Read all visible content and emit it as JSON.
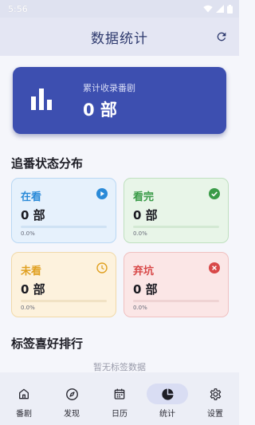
{
  "status_bar": {
    "time": "5:56"
  },
  "app_bar": {
    "title": "数据统计",
    "refresh_icon": "refresh-icon"
  },
  "summary": {
    "label": "累计收录番剧",
    "value": "0 部",
    "icon": "bar-chart-icon"
  },
  "status_section": {
    "title": "追番状态分布",
    "cards": [
      {
        "label": "在看",
        "value": "0 部",
        "percent": "0.0%",
        "progress": 0,
        "icon": "play-circle-icon",
        "accent": "#2a8ad8",
        "bg": "#e6f1fc",
        "border": "#b9d8f4",
        "track": "#cfe2f4"
      },
      {
        "label": "看完",
        "value": "0 部",
        "percent": "0.0%",
        "progress": 0,
        "icon": "check-circle-icon",
        "accent": "#3a9b48",
        "bg": "#e8f5e8",
        "border": "#bfe0bf",
        "track": "#d3e9d3"
      },
      {
        "label": "未看",
        "value": "0 部",
        "percent": "0.0%",
        "progress": 0,
        "icon": "clock-icon",
        "accent": "#e0a020",
        "bg": "#fdf2dd",
        "border": "#f1d9a8",
        "track": "#f1e2c4"
      },
      {
        "label": "弃坑",
        "value": "0 部",
        "percent": "0.0%",
        "progress": 0,
        "icon": "cancel-circle-icon",
        "accent": "#d84848",
        "bg": "#fbe6e6",
        "border": "#f0c0c0",
        "track": "#efd3d3"
      }
    ]
  },
  "tags_section": {
    "title": "标签喜好排行",
    "empty_text": "暂无标签数据"
  },
  "bottom_nav": {
    "items": [
      {
        "label": "番剧",
        "icon": "home-icon",
        "active": false
      },
      {
        "label": "发现",
        "icon": "compass-icon",
        "active": false
      },
      {
        "label": "日历",
        "icon": "calendar-icon",
        "active": false
      },
      {
        "label": "统计",
        "icon": "pie-chart-icon",
        "active": true
      },
      {
        "label": "设置",
        "icon": "gear-icon",
        "active": false
      }
    ]
  },
  "colors": {
    "primary": "#3d4fb0",
    "title": "#2e3a6e"
  }
}
